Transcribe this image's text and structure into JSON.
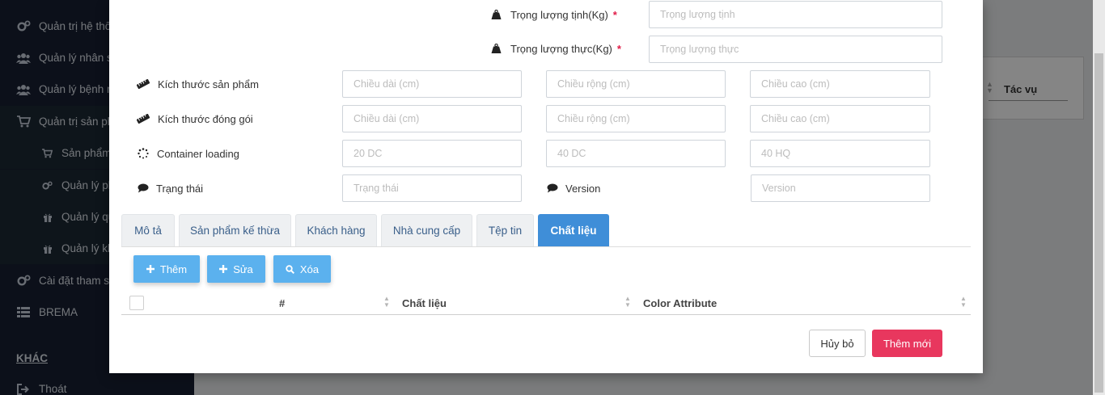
{
  "sidebar": {
    "items": [
      {
        "label": "Quản trị hệ thống",
        "icon": "gears-icon"
      },
      {
        "label": "Quản lý nhân sự",
        "icon": "users-icon"
      },
      {
        "label": "Quản lý bệnh nhân",
        "icon": "users-icon"
      },
      {
        "label": "Quản trị sản phẩm",
        "icon": "cart-icon"
      },
      {
        "label": "Sản phẩm",
        "icon": "cart-icon"
      },
      {
        "label": "Quản lý phân loại",
        "icon": "gears-icon"
      },
      {
        "label": "Quản lý quy cách",
        "icon": "gift-icon"
      },
      {
        "label": "Quản lý kho",
        "icon": "gift-icon"
      },
      {
        "label": "Cài đặt tham số",
        "icon": "gears-icon"
      },
      {
        "label": "BREMA",
        "icon": "table-icon"
      }
    ],
    "section_other": "KHÁC",
    "logout": "Thoát"
  },
  "background": {
    "column_header": "Tác vụ"
  },
  "form": {
    "net_weight": {
      "label": "Trọng lượng tịnh(Kg)",
      "required": "*",
      "placeholder": "Trọng lượng tịnh"
    },
    "actual_weight": {
      "label": "Trọng lượng thực(Kg)",
      "required": "*",
      "placeholder": "Trọng lượng thực"
    },
    "product_size": {
      "label": "Kích thước sản phẩm",
      "length_ph": "Chiều dài (cm)",
      "width_ph": "Chiều rộng (cm)",
      "height_ph": "Chiều cao (cm)"
    },
    "package_size": {
      "label": "Kích thước đóng gói",
      "length_ph": "Chiều dài (cm)",
      "width_ph": "Chiều rộng (cm)",
      "height_ph": "Chiều cao (cm)"
    },
    "container": {
      "label": "Container loading",
      "dc20_ph": "20 DC",
      "dc40_ph": "40 DC",
      "hq40_ph": "40 HQ"
    },
    "status": {
      "label": "Trạng thái",
      "placeholder": "Trạng thái"
    },
    "version": {
      "label": "Version",
      "placeholder": "Version"
    }
  },
  "tabs": [
    {
      "label": "Mô tả"
    },
    {
      "label": "Sản phẩm kế thừa"
    },
    {
      "label": "Khách hàng"
    },
    {
      "label": "Nhà cung cấp"
    },
    {
      "label": "Tệp tin"
    },
    {
      "label": "Chất liệu",
      "active": true
    }
  ],
  "toolbar": {
    "add_label": "Thêm",
    "edit_label": "Sửa",
    "delete_label": "Xóa"
  },
  "table": {
    "columns": [
      "#",
      "Chất liệu",
      "Color Attribute"
    ]
  },
  "footer": {
    "cancel_label": "Hủy bỏ",
    "submit_label": "Thêm mới"
  },
  "colors": {
    "sidebar_bg": "#172033",
    "tab_active": "#3f8ed8",
    "button_blue": "#5bb1ee",
    "submit_red": "#e8375e",
    "required_star": "#e11d48"
  }
}
